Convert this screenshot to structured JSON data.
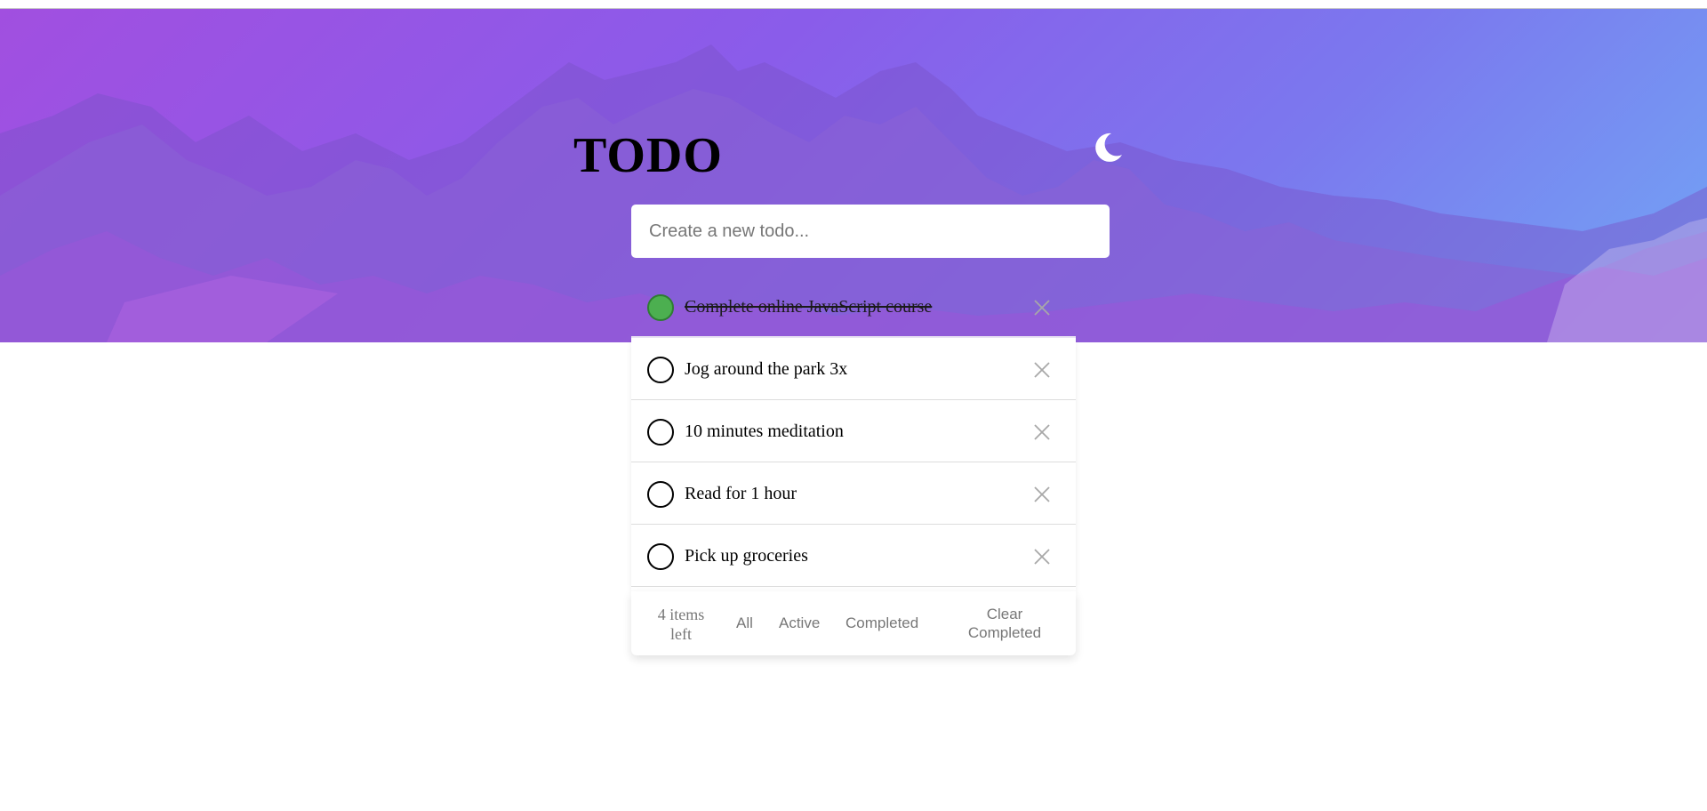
{
  "app": {
    "title": "TODO"
  },
  "header": {
    "theme_toggle_icon": "moon-icon"
  },
  "new_todo": {
    "placeholder": "Create a new todo...",
    "value": ""
  },
  "todos": [
    {
      "text": "Complete online JavaScript course",
      "completed": true
    },
    {
      "text": "Jog around the park 3x",
      "completed": false
    },
    {
      "text": "10 minutes meditation",
      "completed": false
    },
    {
      "text": "Read for 1 hour",
      "completed": false
    },
    {
      "text": "Pick up groceries",
      "completed": false
    }
  ],
  "footer": {
    "items_left_line1": "4 items",
    "items_left_line2": "left",
    "filter_all": "All",
    "filter_active": "Active",
    "filter_completed": "Completed",
    "clear_line1": "Clear",
    "clear_line2": "Completed"
  },
  "colors": {
    "gradient_start": "#a14fe0",
    "gradient_end": "#72a6f5",
    "check_done": "#4caf50"
  }
}
